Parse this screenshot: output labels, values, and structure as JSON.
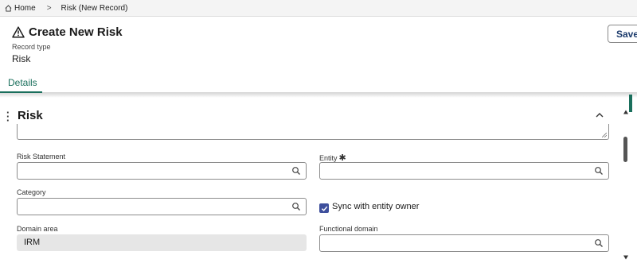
{
  "breadcrumb": {
    "home": "Home",
    "separator": ">",
    "current": "Risk (New Record)"
  },
  "header": {
    "title": "Create New Risk",
    "title_icon": "warning-triangle-icon",
    "record_type_label": "Record type",
    "record_type_value": "Risk",
    "save_label": "Save"
  },
  "tabs": [
    {
      "label": "Details",
      "active": true
    }
  ],
  "section": {
    "title": "Risk",
    "collapsed": false
  },
  "fields": {
    "risk_statement": {
      "label": "Risk Statement",
      "value": ""
    },
    "entity": {
      "label": "Entity",
      "required_mark": "✱",
      "value": ""
    },
    "category": {
      "label": "Category",
      "value": ""
    },
    "sync_with_entity_owner": {
      "label": "Sync with entity owner",
      "checked": true
    },
    "domain_area": {
      "label": "Domain area",
      "value": "IRM"
    },
    "functional_domain": {
      "label": "Functional domain",
      "value": ""
    }
  },
  "colors": {
    "accent": "#1a6f5c",
    "checkbox": "#3e4f9c",
    "save_text": "#1b3a6b"
  }
}
